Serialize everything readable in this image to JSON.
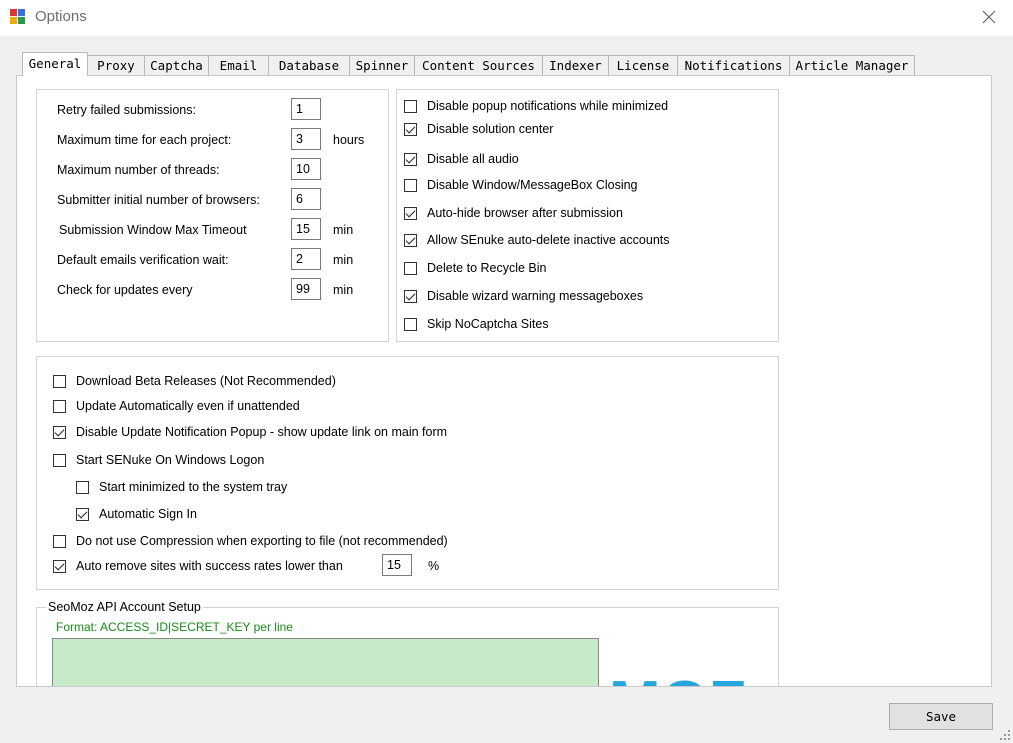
{
  "window": {
    "title": "Options"
  },
  "tabs": [
    "General",
    "Proxy",
    "Captcha",
    "Email",
    "Database",
    "Spinner",
    "Content Sources",
    "Indexer",
    "License",
    "Notifications",
    "Article Manager"
  ],
  "active_tab": "General",
  "general": {
    "numeric": [
      {
        "label": "Retry failed submissions:",
        "value": "1",
        "unit": ""
      },
      {
        "label": "Maximum time for each project:",
        "value": "3",
        "unit": "hours"
      },
      {
        "label": "Maximum number of threads:",
        "value": "10",
        "unit": ""
      },
      {
        "label": "Submitter initial number of browsers:",
        "value": "6",
        "unit": ""
      },
      {
        "label": "Submission Window Max Timeout",
        "value": "15",
        "unit": "min"
      },
      {
        "label": "Default emails verification wait:",
        "value": "2",
        "unit": "min"
      },
      {
        "label": "Check for updates every",
        "value": "99",
        "unit": "min"
      }
    ],
    "options": [
      {
        "label": "Disable popup notifications while minimized",
        "checked": false
      },
      {
        "label": "Disable solution center",
        "checked": true
      },
      {
        "label": "Disable all audio",
        "checked": true
      },
      {
        "label": "Disable Window/MessageBox Closing",
        "checked": false
      },
      {
        "label": "Auto-hide browser after submission",
        "checked": true
      },
      {
        "label": "Allow SEnuke auto-delete inactive accounts",
        "checked": true
      },
      {
        "label": "Delete to Recycle Bin",
        "checked": false
      },
      {
        "label": "Disable wizard warning messageboxes",
        "checked": true
      },
      {
        "label": "Skip NoCaptcha Sites",
        "checked": false
      }
    ],
    "updates": [
      {
        "label": "Download Beta Releases (Not Recommended)",
        "checked": false
      },
      {
        "label": "Update Automatically even if unattended",
        "checked": false
      },
      {
        "label": "Disable Update Notification Popup - show update link on main form",
        "checked": true
      },
      {
        "label": "Start SENuke On Windows Logon",
        "checked": false
      },
      {
        "label": "Start minimized to the system tray",
        "checked": false
      },
      {
        "label": "Automatic Sign In",
        "checked": true
      },
      {
        "label": "Do not use Compression when exporting to file (not recommended)",
        "checked": false
      },
      {
        "label": "Auto remove sites with success rates lower than",
        "checked": true
      }
    ],
    "auto_remove": {
      "value": "15",
      "unit": "%"
    },
    "seomoz": {
      "legend": "SeoMoz API Account Setup",
      "format": "Format: ACCESS_ID|SECRET_KEY per line",
      "logo_text": "MOZ"
    }
  },
  "buttons": {
    "save": "Save"
  },
  "colors": {
    "accent_green": "#1a8a1a",
    "textarea_bg": "#c7ebc8",
    "moz_blue": "#25a7de"
  }
}
